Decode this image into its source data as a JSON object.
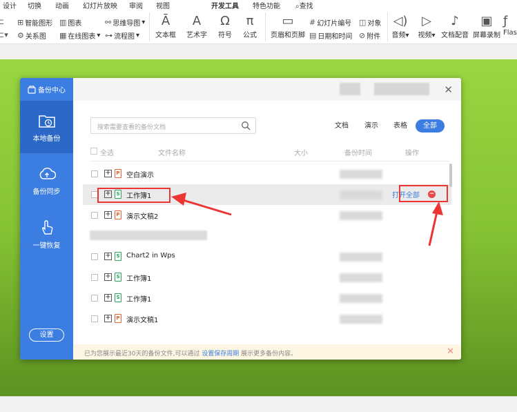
{
  "menu": [
    "设计",
    "切换",
    "动画",
    "幻灯片放映",
    "审阅",
    "视图",
    "开发工具",
    "特色功能",
    "查找"
  ],
  "ribbon": {
    "row1": [
      {
        "label": "智能图形",
        "icon": "smart-graphic-icon"
      },
      {
        "label": "图表",
        "icon": "chart-icon"
      },
      {
        "label": "思维导图",
        "icon": "mindmap-icon"
      },
      {
        "label": "幻灯片编号",
        "icon": "slide-number-icon"
      },
      {
        "label": "对象",
        "icon": "object-icon"
      }
    ],
    "row2": [
      {
        "label": "关系图",
        "icon": "relation-icon"
      },
      {
        "label": "在线图表",
        "icon": "online-chart-icon"
      },
      {
        "label": "流程图",
        "icon": "flowchart-icon"
      },
      {
        "label": "日期和时间",
        "icon": "datetime-icon"
      },
      {
        "label": "附件",
        "icon": "attachment-icon"
      }
    ],
    "big": [
      "文本框",
      "艺术字",
      "符号",
      "公式",
      "页眉和页脚",
      "音频",
      "视频",
      "文档配音",
      "屏幕录制",
      "Flas"
    ]
  },
  "dialog": {
    "title": "备份中心",
    "nav": [
      {
        "label": "本地备份",
        "icon": "folder-clock-icon"
      },
      {
        "label": "备份同步",
        "icon": "cloud-upload-icon"
      },
      {
        "label": "一键恢复",
        "icon": "hand-click-icon"
      }
    ],
    "settings_label": "设置",
    "search_placeholder": "搜索需要查看的备份文档",
    "filters": [
      "文档",
      "演示",
      "表格",
      "全部"
    ],
    "columns": {
      "select_all": "全选",
      "name": "文件名称",
      "size": "大小",
      "time": "备份时间",
      "action": "操作"
    },
    "rows": [
      {
        "name": "空白演示",
        "type": "ppt"
      },
      {
        "name": "工作簿1",
        "type": "xls"
      },
      {
        "name": "演示文稿2",
        "type": "ppt"
      },
      {
        "name": "",
        "type": "blur"
      },
      {
        "name": "Chart2 in Wps",
        "type": "xls"
      },
      {
        "name": "工作簿1",
        "type": "xls"
      },
      {
        "name": "工作簿1",
        "type": "xls"
      },
      {
        "name": "演示文稿1",
        "type": "ppt"
      }
    ],
    "open_all_label": "打开全部",
    "footer": {
      "prefix": "已为您展示最近30天的备份文件,可以通过",
      "link": "设置保存周期",
      "suffix": "展示更多备份内容。"
    }
  },
  "colors": {
    "accent": "#3b7de0",
    "highlight": "#e33333",
    "slide_green": "#86c334"
  }
}
